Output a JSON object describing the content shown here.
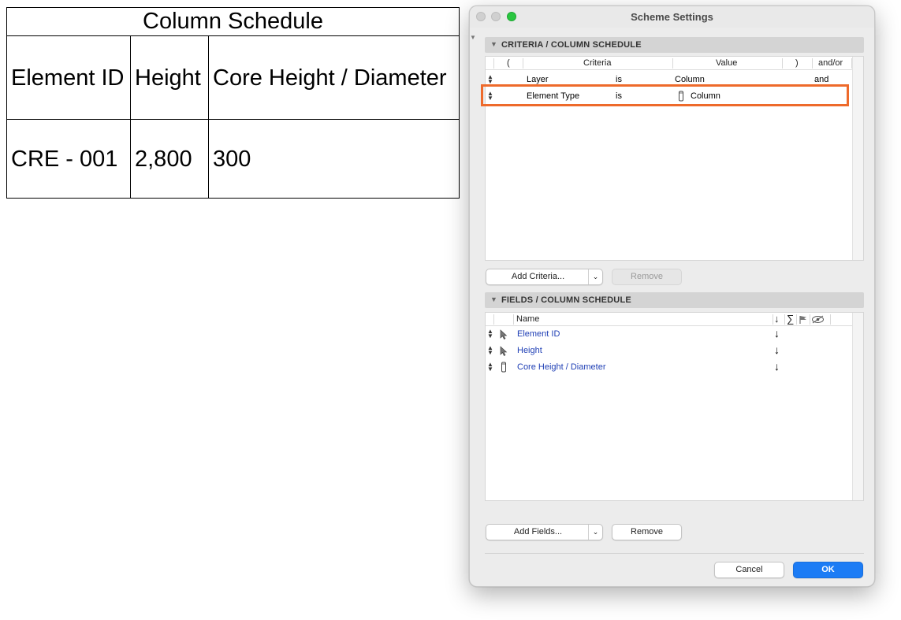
{
  "schedule": {
    "title": "Column Schedule",
    "headers": [
      "Element ID",
      "Height",
      "Core Height / Diameter"
    ],
    "row": [
      "CRE - 001",
      "2,800",
      "300"
    ]
  },
  "dialog": {
    "title": "Scheme Settings",
    "criteria": {
      "header": "CRITERIA /  COLUMN SCHEDULE",
      "columns": {
        "open_paren": "(",
        "criteria": "Criteria",
        "value": "Value",
        "close_paren": ")",
        "andor": "and/or"
      },
      "rows": [
        {
          "criteria": "Layer",
          "operator": "is",
          "value": "Column",
          "andor": "and"
        },
        {
          "criteria": "Element Type",
          "operator": "is",
          "value": "Column",
          "andor": ""
        }
      ],
      "add_label": "Add Criteria...",
      "remove_label": "Remove"
    },
    "fields": {
      "header": "FIELDS /  COLUMN SCHEDULE",
      "columns": {
        "name": "Name",
        "sort": "↓",
        "sum": "∑"
      },
      "rows": [
        {
          "name": "Element ID",
          "sort": "↓"
        },
        {
          "name": "Height",
          "sort": "↓"
        },
        {
          "name": "Core Height / Diameter",
          "sort": "↓"
        }
      ],
      "add_label": "Add Fields...",
      "remove_label": "Remove"
    },
    "cancel_label": "Cancel",
    "ok_label": "OK"
  },
  "colors": {
    "accent": "#1c7cf5",
    "highlight": "#ee6a2b",
    "field_text": "#1f3fb5"
  }
}
